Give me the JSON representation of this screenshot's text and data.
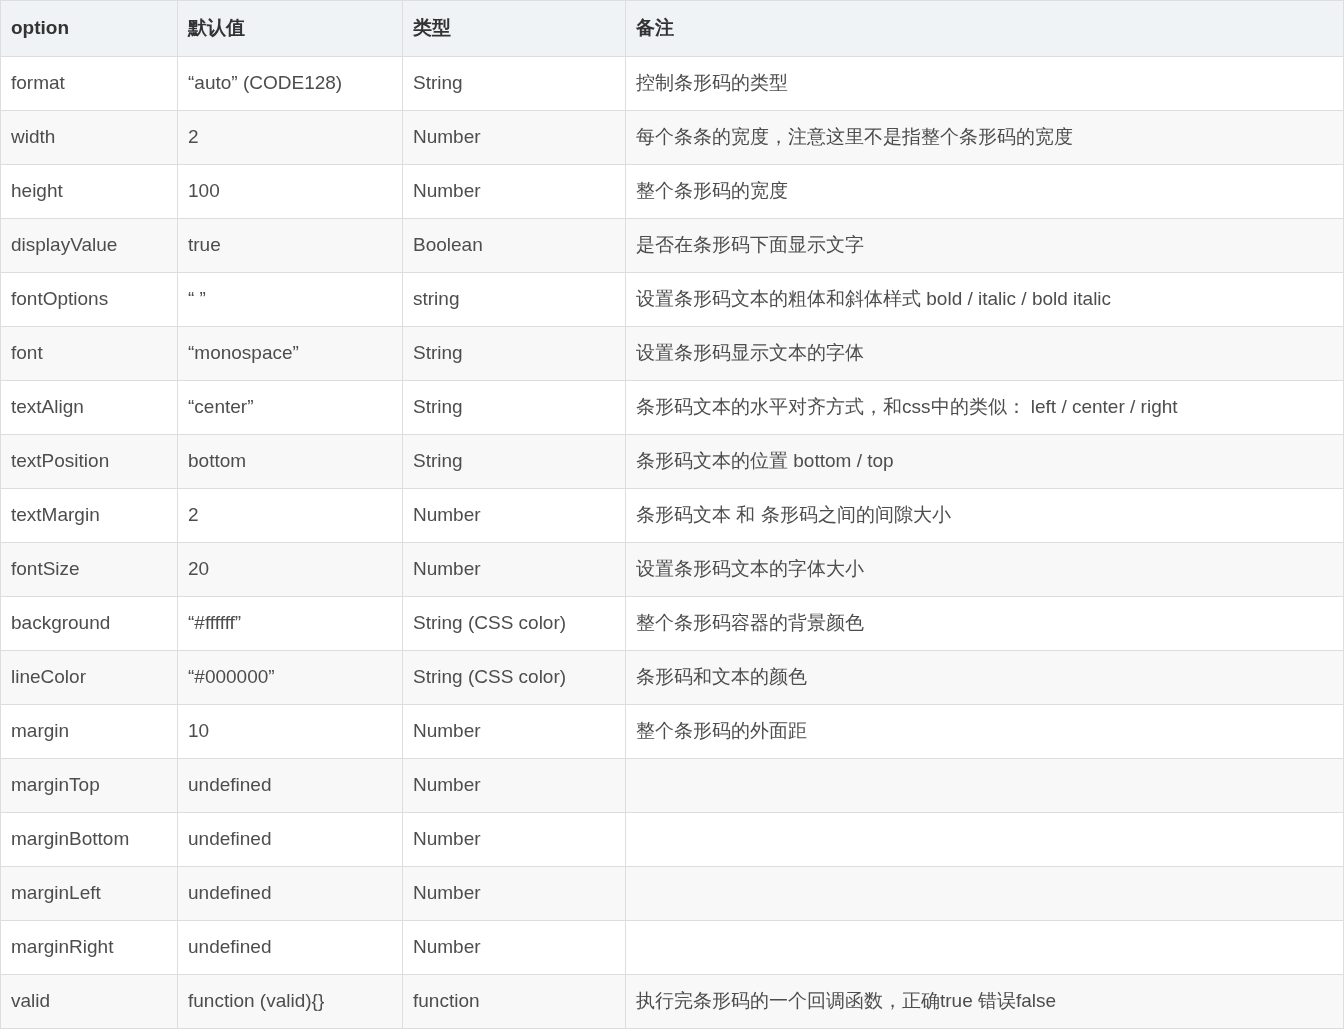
{
  "table": {
    "columns": [
      "option",
      "默认值",
      "类型",
      "备注"
    ],
    "rows": [
      {
        "option": "format",
        "default": "“auto” (CODE128)",
        "type": "String",
        "note": "控制条形码的类型"
      },
      {
        "option": "width",
        "default": "2",
        "type": "Number",
        "note": "每个条条的宽度，注意这里不是指整个条形码的宽度"
      },
      {
        "option": "height",
        "default": "100",
        "type": "Number",
        "note": "整个条形码的宽度"
      },
      {
        "option": "displayValue",
        "default": "true",
        "type": "Boolean",
        "note": "是否在条形码下面显示文字"
      },
      {
        "option": "fontOptions",
        "default": "“ ”",
        "type": "string",
        "note": "设置条形码文本的粗体和斜体样式 bold / italic / bold italic"
      },
      {
        "option": "font",
        "default": "“monospace”",
        "type": "String",
        "note": "设置条形码显示文本的字体"
      },
      {
        "option": "textAlign",
        "default": "“center”",
        "type": "String",
        "note": "条形码文本的水平对齐方式，和css中的类似： left / center / right"
      },
      {
        "option": "textPosition",
        "default": "bottom",
        "type": "String",
        "note": "条形码文本的位置 bottom / top"
      },
      {
        "option": "textMargin",
        "default": "2",
        "type": "Number",
        "note": "条形码文本 和 条形码之间的间隙大小"
      },
      {
        "option": "fontSize",
        "default": "20",
        "type": "Number",
        "note": "设置条形码文本的字体大小"
      },
      {
        "option": "background",
        "default": "“#ffffff”",
        "type": "String (CSS color)",
        "note": "整个条形码容器的背景颜色"
      },
      {
        "option": "lineColor",
        "default": "“#000000”",
        "type": "String (CSS color)",
        "note": "条形码和文本的颜色"
      },
      {
        "option": "margin",
        "default": "10",
        "type": "Number",
        "note": "整个条形码的外面距"
      },
      {
        "option": "marginTop",
        "default": "undefined",
        "type": "Number"
      },
      {
        "option": "marginBottom",
        "default": "undefined",
        "type": "Number"
      },
      {
        "option": "marginLeft",
        "default": "undefined",
        "type": "Number"
      },
      {
        "option": "marginRight",
        "default": "undefined",
        "type": "Number"
      },
      {
        "option": "valid",
        "default": "function (valid){}",
        "type": "function",
        "note": "执行完条形码的一个回调函数，正确true 错误false"
      }
    ]
  }
}
